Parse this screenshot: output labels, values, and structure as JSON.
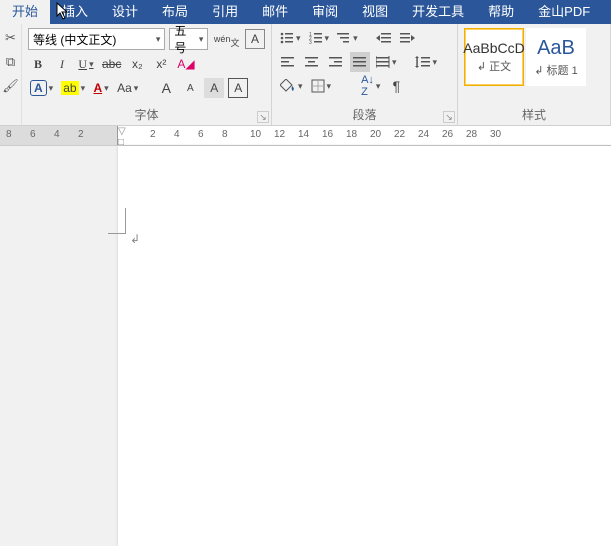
{
  "tabs": [
    "开始",
    "插入",
    "设计",
    "布局",
    "引用",
    "邮件",
    "审阅",
    "视图",
    "开发工具",
    "帮助",
    "金山PDF"
  ],
  "font": {
    "name": "等线 (中文正文)",
    "size": "五号",
    "phonetic": "wén",
    "clear": "A",
    "bold": "B",
    "italic": "I",
    "underline": "U",
    "strike": "abc",
    "sub": "x₂",
    "sup": "x²",
    "effects": "A",
    "highlight": "ab",
    "color": "A",
    "case": "Aa",
    "grow": "A",
    "shrink": "A",
    "charshade": "A",
    "charborder": "A",
    "group": "字体"
  },
  "para": {
    "group": "段落"
  },
  "styles": {
    "group": "样式",
    "items": [
      {
        "preview": "AaBbCcD",
        "name": "↲ 正文"
      },
      {
        "preview": "AaB",
        "name": "↲ 标题 1"
      }
    ]
  },
  "ruler": [
    8,
    6,
    4,
    2,
    2,
    4,
    6,
    8,
    10,
    12,
    14,
    16,
    18,
    20,
    22,
    24,
    26,
    28,
    30
  ]
}
